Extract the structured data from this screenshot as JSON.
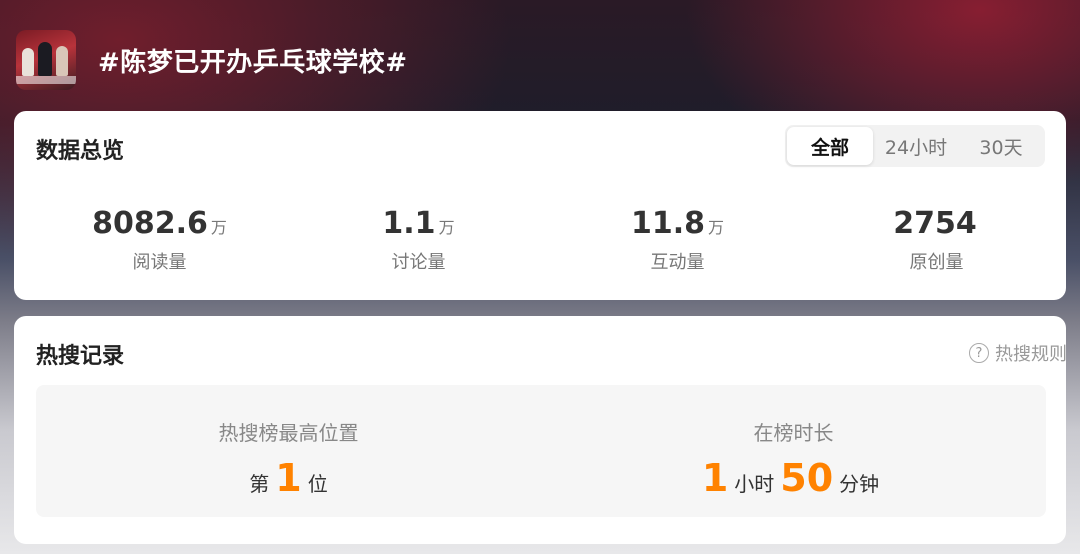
{
  "topic": {
    "title": "#陈梦已开办乒乓球学校#"
  },
  "overview": {
    "title": "数据总览",
    "filters": [
      "全部",
      "24小时",
      "30天"
    ],
    "active_filter": "全部",
    "stats": [
      {
        "value": "8082.6",
        "unit": "万",
        "label": "阅读量"
      },
      {
        "value": "1.1",
        "unit": "万",
        "label": "讨论量"
      },
      {
        "value": "11.8",
        "unit": "万",
        "label": "互动量"
      },
      {
        "value": "2754",
        "unit": "",
        "label": "原创量"
      }
    ]
  },
  "hot_record": {
    "title": "热搜记录",
    "rules_label": "热搜规则",
    "rules_icon": "question-circle-icon",
    "highest": {
      "label": "热搜榜最高位置",
      "prefix": "第",
      "value": "1",
      "suffix": "位"
    },
    "duration": {
      "label": "在榜时长",
      "hours": "1",
      "hours_unit": "小时",
      "minutes": "50",
      "minutes_unit": "分钟"
    }
  },
  "colors": {
    "accent": "#ff8200",
    "card": "#ffffff",
    "text": "#333333"
  }
}
